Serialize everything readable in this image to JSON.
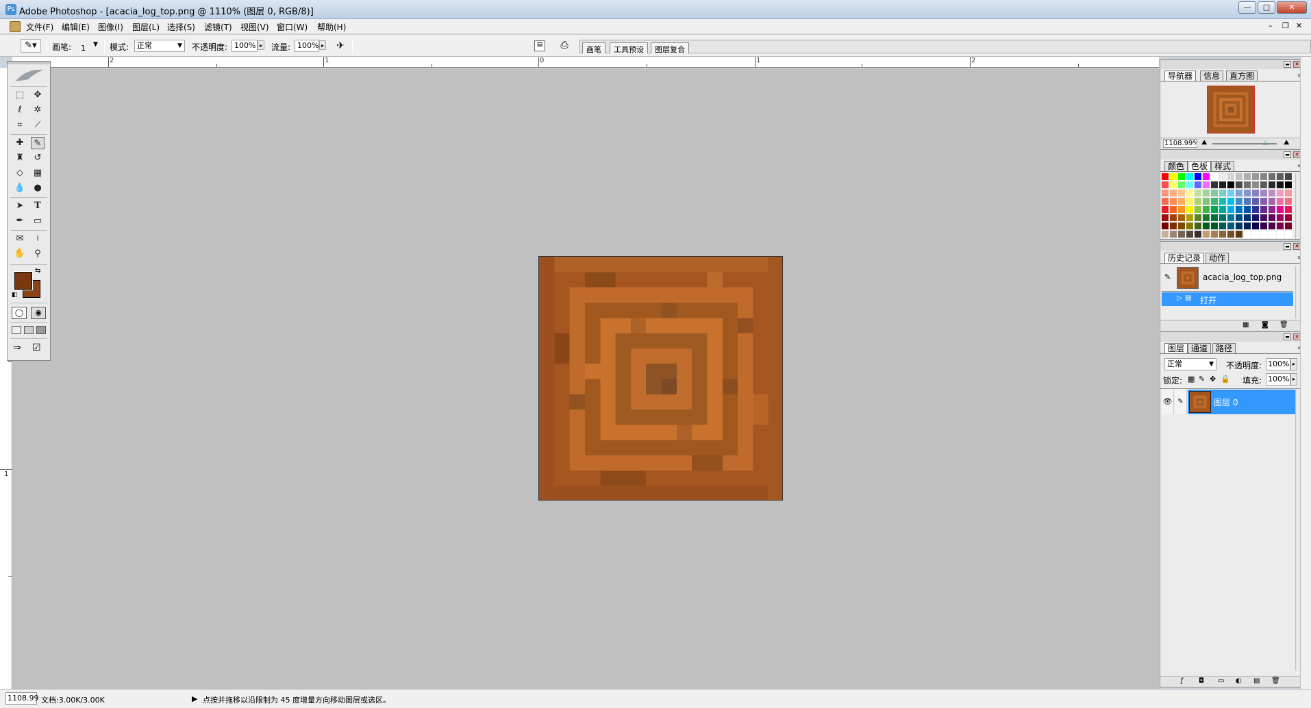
{
  "window": {
    "title": "Adobe Photoshop - [acacia_log_top.png @ 1110% (图层 0, RGB/8)]",
    "controls": {
      "minimize": "—",
      "maximize": "□",
      "close": "✕"
    }
  },
  "menubar": {
    "items": [
      "文件(F)",
      "编辑(E)",
      "图像(I)",
      "图层(L)",
      "选择(S)",
      "滤镜(T)",
      "视图(V)",
      "窗口(W)",
      "帮助(H)"
    ],
    "doc_controls": {
      "minimize": "–",
      "restore": "❐",
      "close": "✕"
    }
  },
  "options_bar": {
    "brush_label": "画笔:",
    "brush_size": "1",
    "mode_label": "模式:",
    "mode_value": "正常",
    "opacity_label": "不透明度:",
    "opacity_value": "100%",
    "flow_label": "流量:",
    "flow_value": "100%",
    "well_tabs": [
      "画笔",
      "工具预设",
      "图层复合"
    ]
  },
  "rulers": {
    "top_labels": [
      "2",
      "1",
      "0",
      "1",
      "2"
    ],
    "left_labels": [
      "1"
    ]
  },
  "navigator_panel": {
    "tabs": [
      "导航器",
      "信息",
      "直方图"
    ],
    "zoom_value": "1108.99%"
  },
  "swatches_panel": {
    "tabs": [
      "颜色",
      "色板",
      "样式"
    ]
  },
  "history_panel": {
    "tabs": [
      "历史记录",
      "动作"
    ],
    "snapshot_name": "acacia_log_top.png",
    "steps": [
      "打开"
    ]
  },
  "layers_panel": {
    "tabs": [
      "图层",
      "通道",
      "路径"
    ],
    "blend_mode": "正常",
    "opacity_label": "不透明度:",
    "opacity_value": "100%",
    "lock_label": "锁定:",
    "fill_label": "填充:",
    "fill_value": "100%",
    "layers": [
      "图层 0"
    ]
  },
  "statusbar": {
    "zoom": "1108.99",
    "doc_size": "文档:3.00K/3.00K",
    "hint": "点按并拖移以沿限制为 45 度增量方向移动图层或选区。"
  },
  "colors": {
    "foreground": "#7a3810",
    "background": "#8a4418",
    "canvas_bg": "#c0c0c0",
    "selection": "#3399ff"
  }
}
